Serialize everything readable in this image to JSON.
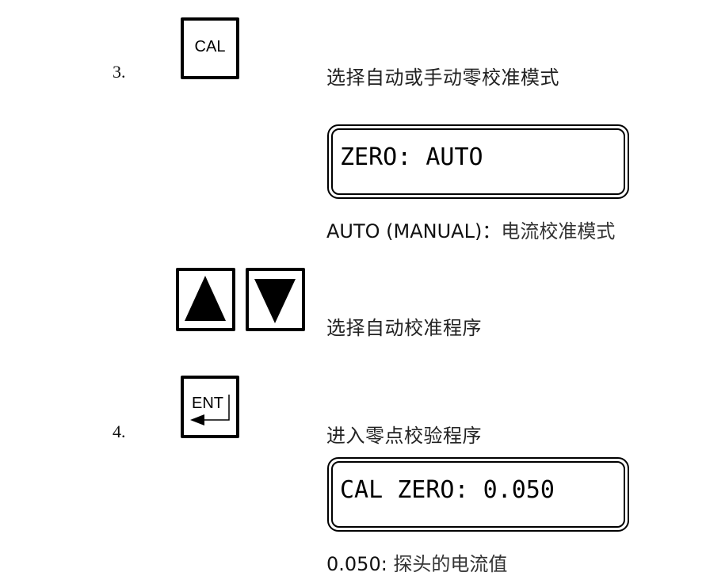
{
  "steps": [
    {
      "number": "3.",
      "key": {
        "label": "CAL",
        "icon": "cal-key"
      },
      "description": "选择自动或手动零校准模式",
      "display": {
        "text": "ZERO: AUTO"
      },
      "note": {
        "prefix": "AUTO (MANUAL)：",
        "text": "电流校准模式"
      },
      "sub": {
        "keys": [
          {
            "icon": "up-arrow-key"
          },
          {
            "icon": "down-arrow-key"
          }
        ],
        "description": "选择自动校准程序"
      }
    },
    {
      "number": "4.",
      "key": {
        "label": "ENT",
        "icon": "enter-key"
      },
      "description": "进入零点校验程序",
      "display": {
        "text": "CAL ZERO: 0.050"
      },
      "note": {
        "prefix": "0.050: ",
        "text": "探头的电流值"
      }
    }
  ]
}
